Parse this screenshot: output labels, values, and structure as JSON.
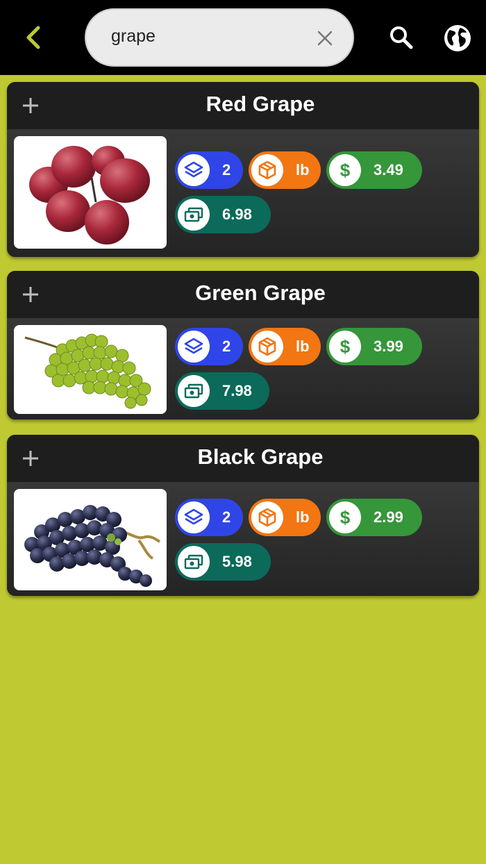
{
  "search": {
    "query": "grape"
  },
  "colors": {
    "background": "#bfc931",
    "topbar": "#000000",
    "accent": "#bfc931",
    "qty_pill": "#2f45e8",
    "unit_pill": "#f27612",
    "price_pill": "#35963a",
    "total_pill": "#0b6a5a"
  },
  "icons": {
    "back": "chevron-left-icon",
    "clear": "close-icon",
    "search": "search-icon",
    "language": "globe-icon",
    "add": "plus-icon",
    "quantity": "layers-icon",
    "unit": "box-icon",
    "price": "dollar-icon",
    "total": "money-icon"
  },
  "items": [
    {
      "name": "Red Grape",
      "quantity": "2",
      "unit": "lb",
      "price": "3.49",
      "total": "6.98",
      "image": "red grapes photo"
    },
    {
      "name": "Green Grape",
      "quantity": "2",
      "unit": "lb",
      "price": "3.99",
      "total": "7.98",
      "image": "green grapes photo"
    },
    {
      "name": "Black Grape",
      "quantity": "2",
      "unit": "lb",
      "price": "2.99",
      "total": "5.98",
      "image": "black grapes photo"
    }
  ]
}
